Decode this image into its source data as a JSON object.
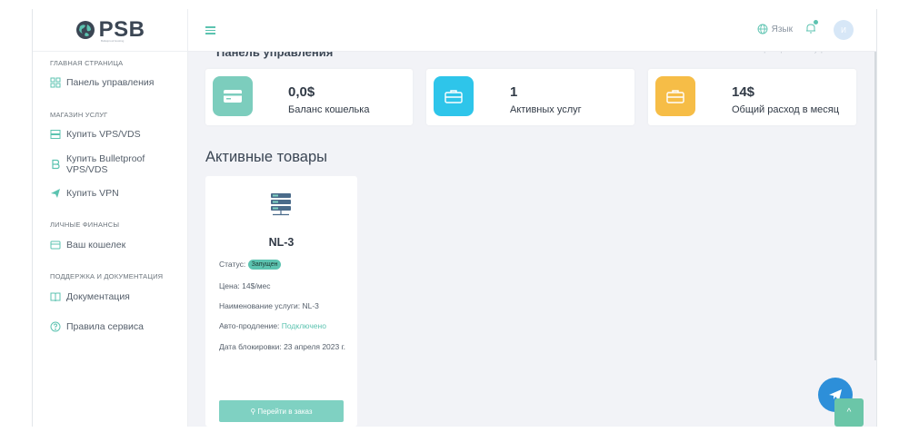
{
  "brand": {
    "logo_text": "PSB",
    "logo_subtitle": "Bulletproof Hosting"
  },
  "sidebar": {
    "sections": [
      {
        "title": "ГЛАВНАЯ СТРАНИЦА"
      },
      {
        "title": "МАГАЗИН УСЛУГ"
      },
      {
        "title": "ЛИЧНЫЕ ФИНАНСЫ"
      },
      {
        "title": "ПОДДЕРЖКА И ДОКУМЕНТАЦИЯ"
      }
    ],
    "items": [
      {
        "label": "Панель управления",
        "icon": "grid-icon"
      },
      {
        "label": "Купить VPS/VDS",
        "icon": "server-icon"
      },
      {
        "label": "Купить Bulletproof VPS/VDS",
        "icon": "bold-b-icon"
      },
      {
        "label": "Купить VPN",
        "icon": "send-icon"
      },
      {
        "label": "Ваш кошелек",
        "icon": "wallet-icon"
      },
      {
        "label": "Документация",
        "icon": "book-icon"
      },
      {
        "label": "Правила сервиса",
        "icon": "question-icon"
      }
    ]
  },
  "topbar": {
    "language_label": "Язык",
    "avatar_initial": "И"
  },
  "page": {
    "title": "Панель управления",
    "breadcrumb": "Главная страница / Панель управления"
  },
  "stats": [
    {
      "value": "0,0$",
      "label": "Баланс кошелька",
      "color": "#7ccdbd"
    },
    {
      "value": "1",
      "label": "Активных услуг",
      "color": "#2ec5ea"
    },
    {
      "value": "14$",
      "label": "Общий расход в месяц",
      "color": "#f6bd47"
    }
  ],
  "products_section": {
    "title": "Активные товары"
  },
  "product": {
    "name": "NL-3",
    "status_label": "Статус:",
    "status_value": "Запущен",
    "price": "Цена: 14$/мес",
    "service_name": "Наименование услуги: NL-3",
    "renew_label": "Авто-продление:",
    "renew_value": "Подключено",
    "block_date": "Дата блокировки: 23 апреля 2023 г.",
    "button_label": "Перейти в заказ"
  },
  "floating": {
    "scroll_top_glyph": "^"
  }
}
